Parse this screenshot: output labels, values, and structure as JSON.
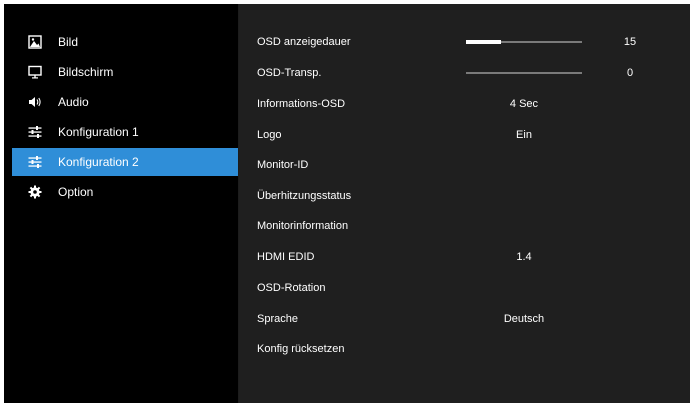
{
  "sidebar": {
    "items": [
      {
        "label": "Bild",
        "icon": "picture-icon",
        "active": false
      },
      {
        "label": "Bildschirm",
        "icon": "monitor-icon",
        "active": false
      },
      {
        "label": "Audio",
        "icon": "speaker-icon",
        "active": false
      },
      {
        "label": "Konfiguration 1",
        "icon": "sliders-icon",
        "active": false
      },
      {
        "label": "Konfiguration 2",
        "icon": "sliders-icon",
        "active": true
      },
      {
        "label": "Option",
        "icon": "gear-icon",
        "active": false
      }
    ]
  },
  "settings": {
    "osd_display_time": {
      "label": "OSD anzeigedauer",
      "value": "15",
      "level": 0.3
    },
    "osd_transparency": {
      "label": "OSD-Transp.",
      "value": "0",
      "level": 0.0
    },
    "info_osd": {
      "label": "Informations-OSD",
      "value": "4 Sec"
    },
    "logo": {
      "label": "Logo",
      "value": "Ein"
    },
    "monitor_id": {
      "label": "Monitor-ID"
    },
    "heat_status": {
      "label": "Überhitzungsstatus"
    },
    "monitor_info": {
      "label": "Monitorinformation"
    },
    "hdmi_edid": {
      "label": "HDMI EDID",
      "value": "1.4"
    },
    "osd_rotation": {
      "label": "OSD-Rotation"
    },
    "language": {
      "label": "Sprache",
      "value": "Deutsch"
    },
    "reset_config": {
      "label": "Konfig rücksetzen"
    }
  },
  "colors": {
    "active_highlight": "#2f8ed8",
    "sidebar_bg": "#000000",
    "content_bg": "#1f1f1f"
  }
}
